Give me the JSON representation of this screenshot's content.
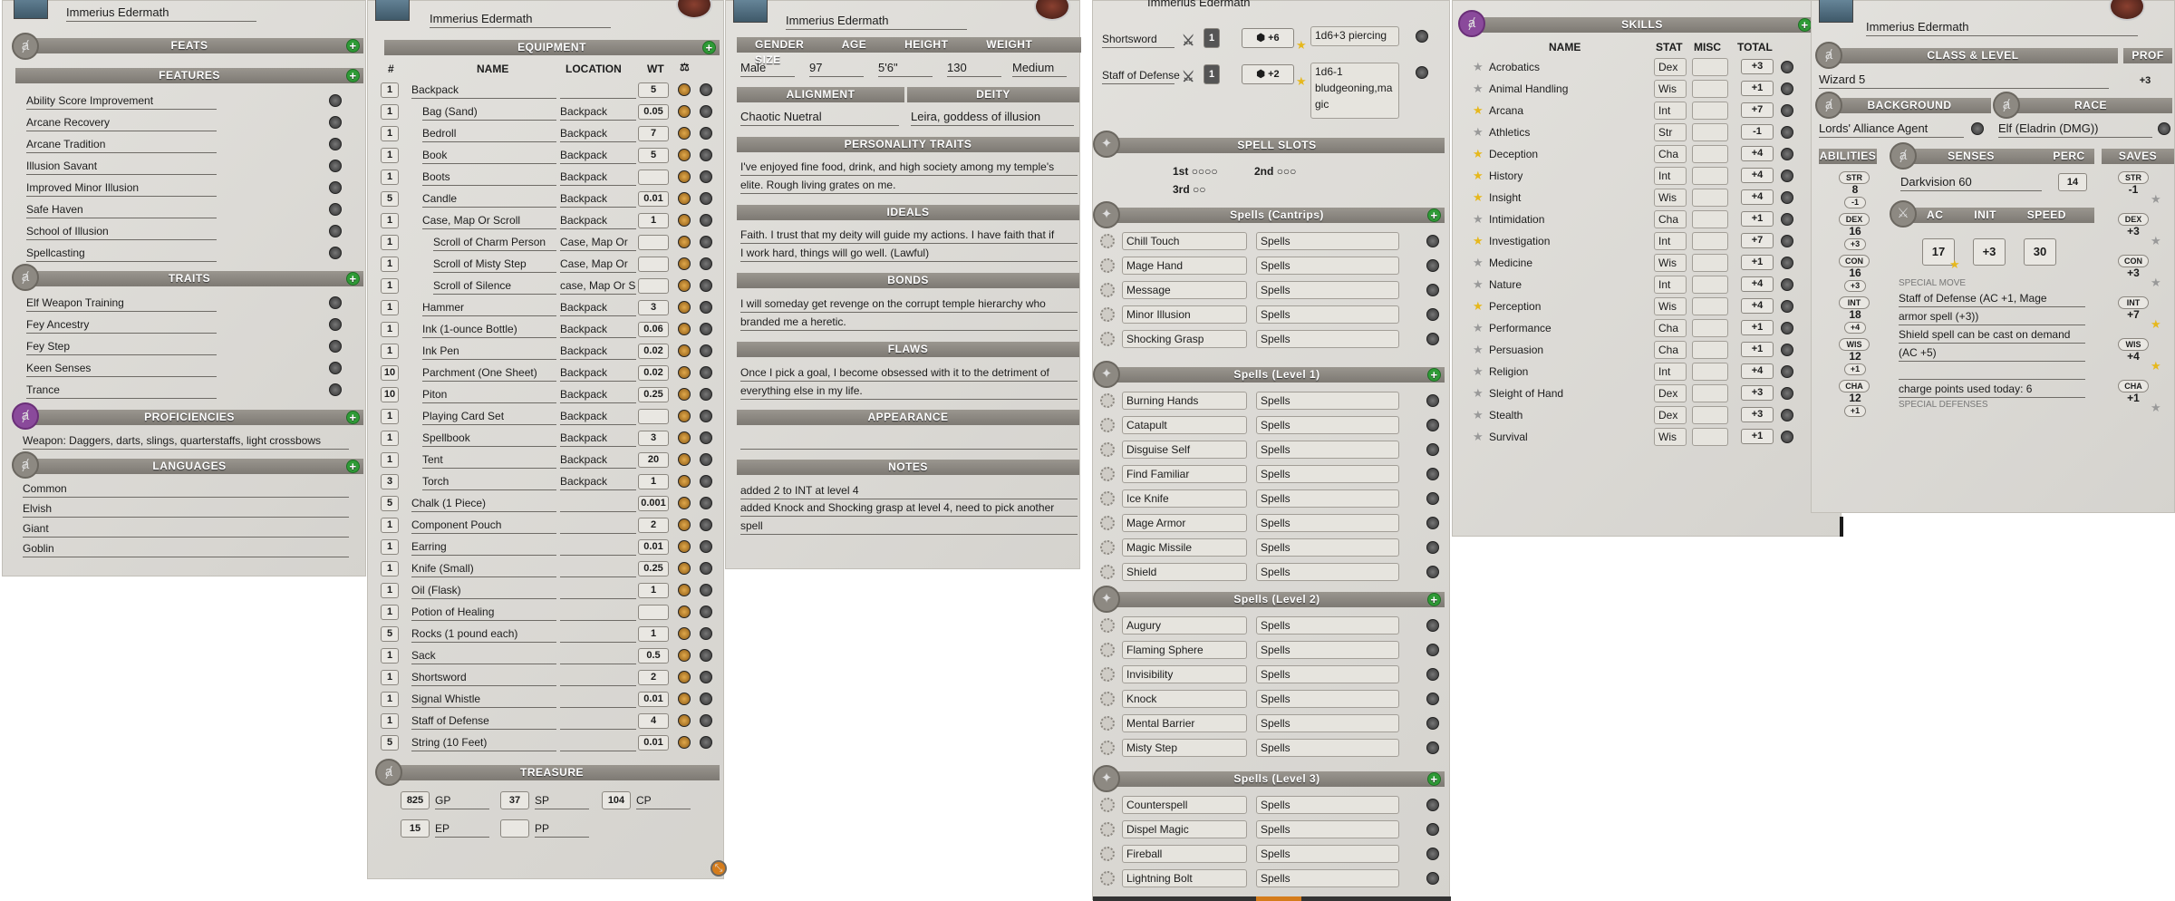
{
  "character_name": "Immerius Edermath",
  "panel1": {
    "feats_header": "FEATS",
    "features_header": "FEATURES",
    "features": [
      "Ability Score Improvement",
      "Arcane Recovery",
      "Arcane Tradition",
      "Illusion Savant",
      "Improved Minor Illusion",
      "Safe Haven",
      "School of Illusion",
      "Spellcasting"
    ],
    "traits_header": "TRAITS",
    "traits": [
      "Elf Weapon Training",
      "Fey Ancestry",
      "Fey Step",
      "Keen Senses",
      "Trance"
    ],
    "proficiencies_header": "PROFICIENCIES",
    "proficiencies": "Weapon: Daggers, darts, slings, quarterstaffs, light crossbows",
    "languages_header": "LANGUAGES",
    "languages": [
      "Common",
      "Elvish",
      "Giant",
      "Goblin"
    ]
  },
  "panel2": {
    "header": "EQUIPMENT",
    "col_num": "#",
    "col_name": "NAME",
    "col_loc": "LOCATION",
    "col_wt": "WT",
    "items": [
      {
        "n": "1",
        "name": "Backpack",
        "loc": "",
        "wt": "5",
        "indent": 0
      },
      {
        "n": "1",
        "name": "Bag (Sand)",
        "loc": "Backpack",
        "wt": "0.05",
        "indent": 1
      },
      {
        "n": "1",
        "name": "Bedroll",
        "loc": "Backpack",
        "wt": "7",
        "indent": 1
      },
      {
        "n": "1",
        "name": "Book",
        "loc": "Backpack",
        "wt": "5",
        "indent": 1
      },
      {
        "n": "1",
        "name": "Boots",
        "loc": "Backpack",
        "wt": "",
        "indent": 1
      },
      {
        "n": "5",
        "name": "Candle",
        "loc": "Backpack",
        "wt": "0.01",
        "indent": 1
      },
      {
        "n": "1",
        "name": "Case, Map Or Scroll",
        "loc": "Backpack",
        "wt": "1",
        "indent": 1
      },
      {
        "n": "1",
        "name": "Scroll of Charm Person",
        "loc": "Case, Map Or",
        "wt": "",
        "indent": 2
      },
      {
        "n": "1",
        "name": "Scroll of Misty Step",
        "loc": "Case, Map Or",
        "wt": "",
        "indent": 2
      },
      {
        "n": "1",
        "name": "Scroll of Silence",
        "loc": "case, Map Or S",
        "wt": "",
        "indent": 2
      },
      {
        "n": "1",
        "name": "Hammer",
        "loc": "Backpack",
        "wt": "3",
        "indent": 1
      },
      {
        "n": "1",
        "name": "Ink (1-ounce Bottle)",
        "loc": "Backpack",
        "wt": "0.06",
        "indent": 1
      },
      {
        "n": "1",
        "name": "Ink Pen",
        "loc": "Backpack",
        "wt": "0.02",
        "indent": 1
      },
      {
        "n": "10",
        "name": "Parchment (One Sheet)",
        "loc": "Backpack",
        "wt": "0.02",
        "indent": 1
      },
      {
        "n": "10",
        "name": "Piton",
        "loc": "Backpack",
        "wt": "0.25",
        "indent": 1
      },
      {
        "n": "1",
        "name": "Playing Card Set",
        "loc": "Backpack",
        "wt": "",
        "indent": 1
      },
      {
        "n": "1",
        "name": "Spellbook",
        "loc": "Backpack",
        "wt": "3",
        "indent": 1
      },
      {
        "n": "1",
        "name": "Tent",
        "loc": "Backpack",
        "wt": "20",
        "indent": 1
      },
      {
        "n": "3",
        "name": "Torch",
        "loc": "Backpack",
        "wt": "1",
        "indent": 1
      },
      {
        "n": "5",
        "name": "Chalk (1 Piece)",
        "loc": "",
        "wt": "0.001",
        "indent": 0
      },
      {
        "n": "1",
        "name": "Component Pouch",
        "loc": "",
        "wt": "2",
        "indent": 0
      },
      {
        "n": "1",
        "name": "Earring",
        "loc": "",
        "wt": "0.01",
        "indent": 0
      },
      {
        "n": "1",
        "name": "Knife (Small)",
        "loc": "",
        "wt": "0.25",
        "indent": 0
      },
      {
        "n": "1",
        "name": "Oil (Flask)",
        "loc": "",
        "wt": "1",
        "indent": 0
      },
      {
        "n": "1",
        "name": "Potion of Healing",
        "loc": "",
        "wt": "",
        "indent": 0
      },
      {
        "n": "5",
        "name": "Rocks (1 pound each)",
        "loc": "",
        "wt": "1",
        "indent": 0
      },
      {
        "n": "1",
        "name": "Sack",
        "loc": "",
        "wt": "0.5",
        "indent": 0
      },
      {
        "n": "1",
        "name": "Shortsword",
        "loc": "",
        "wt": "2",
        "indent": 0
      },
      {
        "n": "1",
        "name": "Signal Whistle",
        "loc": "",
        "wt": "0.01",
        "indent": 0
      },
      {
        "n": "1",
        "name": "Staff of Defense",
        "loc": "",
        "wt": "4",
        "indent": 0
      },
      {
        "n": "5",
        "name": "String (10 Feet)",
        "loc": "",
        "wt": "0.01",
        "indent": 0
      }
    ],
    "treasure_header": "TREASURE",
    "coins": [
      {
        "v": "825",
        "l": "GP"
      },
      {
        "v": "37",
        "l": "SP"
      },
      {
        "v": "104",
        "l": "CP"
      },
      {
        "v": "15",
        "l": "EP"
      },
      {
        "v": "",
        "l": "PP"
      }
    ]
  },
  "panel3": {
    "labels": {
      "gender": "GENDER",
      "age": "AGE",
      "height": "HEIGHT",
      "weight": "WEIGHT",
      "size": "SIZE",
      "alignment": "ALIGNMENT",
      "deity": "DEITY"
    },
    "gender": "Male",
    "age": "97",
    "height": "5'6\"",
    "weight": "130",
    "size": "Medium",
    "alignment": "Chaotic Nuetral",
    "deity": "Leira, goddess of illusion",
    "personality_header": "PERSONALITY TRAITS",
    "personality": [
      "I've enjoyed fine food, drink, and high society among my temple's",
      "elite. Rough living grates on me."
    ],
    "ideals_header": "IDEALS",
    "ideals": [
      "Faith. I trust that my deity will guide my actions. I have faith that if",
      "I work hard, things will go well. (Lawful)"
    ],
    "bonds_header": "BONDS",
    "bonds": [
      "I will someday get revenge on the corrupt temple hierarchy who",
      "branded me a heretic."
    ],
    "flaws_header": "FLAWS",
    "flaws": [
      "Once I pick a goal, I become obsessed with it to the detriment of",
      "everything else in my life."
    ],
    "appearance_header": "APPEARANCE",
    "notes_header": "NOTES",
    "notes": [
      "added 2 to INT at level 4",
      "added Knock and Shocking grasp at level 4, need to pick another",
      "spell"
    ]
  },
  "panel4": {
    "weapons": [
      {
        "name": "Shortsword",
        "bonus": "+6",
        "dmg": [
          "1d6+3 piercing"
        ]
      },
      {
        "name": "Staff of Defense",
        "bonus": "+2",
        "dmg": [
          "1d6-1",
          "bludgeoning,ma",
          "gic"
        ]
      }
    ],
    "weapon_count": "1",
    "slots_header": "SPELL SLOTS",
    "slot_1": "1st",
    "slot_2": "2nd",
    "slot_3": "3rd",
    "slot_marks_1": "○○○○",
    "slot_marks_2": "○○○",
    "slot_marks_3": "○○",
    "spell_groups": [
      {
        "header": "Spells (Cantrips)",
        "spells": [
          "Chill Touch",
          "Mage Hand",
          "Message",
          "Minor Illusion",
          "Shocking Grasp"
        ]
      },
      {
        "header": "Spells (Level 1)",
        "spells": [
          "Burning Hands",
          "Catapult",
          "Disguise Self",
          "Find Familiar",
          "Ice Knife",
          "Mage Armor",
          "Magic Missile",
          "Shield"
        ]
      },
      {
        "header": "Spells (Level 2)",
        "spells": [
          "Augury",
          "Flaming Sphere",
          "Invisibility",
          "Knock",
          "Mental Barrier",
          "Misty Step"
        ]
      },
      {
        "header": "Spells (Level 3)",
        "spells": [
          "Counterspell",
          "Dispel Magic",
          "Fireball",
          "Lightning Bolt"
        ]
      }
    ],
    "spell_source": "Spells"
  },
  "panel5": {
    "header": "SKILLS",
    "col_name": "NAME",
    "col_stat": "STAT",
    "col_misc": "MISC",
    "col_total": "TOTAL",
    "skills": [
      {
        "name": "Acrobatics",
        "stat": "Dex",
        "total": "+3",
        "prof": false
      },
      {
        "name": "Animal Handling",
        "stat": "Wis",
        "total": "+1",
        "prof": false
      },
      {
        "name": "Arcana",
        "stat": "Int",
        "total": "+7",
        "prof": true
      },
      {
        "name": "Athletics",
        "stat": "Str",
        "total": "-1",
        "prof": false
      },
      {
        "name": "Deception",
        "stat": "Cha",
        "total": "+4",
        "prof": true
      },
      {
        "name": "History",
        "stat": "Int",
        "total": "+4",
        "prof": true
      },
      {
        "name": "Insight",
        "stat": "Wis",
        "total": "+4",
        "prof": true
      },
      {
        "name": "Intimidation",
        "stat": "Cha",
        "total": "+1",
        "prof": false
      },
      {
        "name": "Investigation",
        "stat": "Int",
        "total": "+7",
        "prof": true
      },
      {
        "name": "Medicine",
        "stat": "Wis",
        "total": "+1",
        "prof": false
      },
      {
        "name": "Nature",
        "stat": "Int",
        "total": "+4",
        "prof": false
      },
      {
        "name": "Perception",
        "stat": "Wis",
        "total": "+4",
        "prof": true
      },
      {
        "name": "Performance",
        "stat": "Cha",
        "total": "+1",
        "prof": false
      },
      {
        "name": "Persuasion",
        "stat": "Cha",
        "total": "+1",
        "prof": false
      },
      {
        "name": "Religion",
        "stat": "Int",
        "total": "+4",
        "prof": false
      },
      {
        "name": "Sleight of Hand",
        "stat": "Dex",
        "total": "+3",
        "prof": false
      },
      {
        "name": "Stealth",
        "stat": "Dex",
        "total": "+3",
        "prof": false
      },
      {
        "name": "Survival",
        "stat": "Wis",
        "total": "+1",
        "prof": false
      }
    ]
  },
  "panel6": {
    "class_header": "CLASS & LEVEL",
    "prof_header": "PROF",
    "class_level": "Wizard 5",
    "prof": "+3",
    "background_header": "BACKGROUND",
    "race_header": "RACE",
    "background": "Lords' Alliance Agent",
    "race": "Elf (Eladrin (DMG))",
    "abilities_header": "ABILITIES",
    "senses_header": "SENSES",
    "perc_header": "PERC",
    "saves_header": "SAVES",
    "senses": "Darkvision 60",
    "perc": "14",
    "abilities": [
      {
        "name": "STR",
        "score": "8",
        "mod": "-1",
        "save": "-1"
      },
      {
        "name": "DEX",
        "score": "16",
        "mod": "+3",
        "save": "+3"
      },
      {
        "name": "CON",
        "score": "16",
        "mod": "+3",
        "save": "+3"
      },
      {
        "name": "INT",
        "score": "18",
        "mod": "+4",
        "save": "+7"
      },
      {
        "name": "WIS",
        "score": "12",
        "mod": "+1",
        "save": "+4"
      },
      {
        "name": "CHA",
        "score": "12",
        "mod": "+1",
        "save": "+1"
      }
    ],
    "ac_header": "AC",
    "init_header": "INIT",
    "speed_header": "SPEED",
    "ac": "17",
    "init": "+3",
    "speed": "30",
    "special_move": "SPECIAL MOVE",
    "defense_lines": [
      "Staff of Defense (AC +1, Mage",
      "armor spell (+3))",
      "Shield spell can be cast on demand",
      "(AC +5)",
      "",
      "charge points used today: 6"
    ],
    "special_defenses": "SPECIAL DEFENSES"
  },
  "colors": {
    "header": "#8a867f",
    "panel": "#dcdad5",
    "plus": "#2e9b36",
    "star": "#e6b81d",
    "accent_purple": "#8a4a9b"
  }
}
